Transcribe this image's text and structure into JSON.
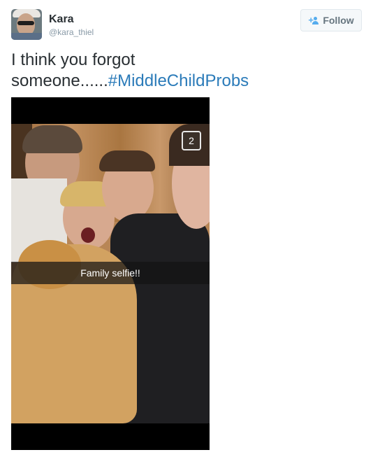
{
  "author": {
    "name": "Kara",
    "handle": "@kara_thiel",
    "avatar_icon": "profile-avatar"
  },
  "follow_button": {
    "label": "Follow",
    "icon": "add-user-icon"
  },
  "tweet": {
    "text_line1": "I think you forgot",
    "text_line2_prefix": "someone......",
    "hashtag": "#MiddleChildProbs"
  },
  "photo": {
    "caption": "Family selfie!!",
    "badge": "2"
  },
  "colors": {
    "hashtag": "#2b7bb9",
    "follow_icon": "#55acee",
    "text": "#292f33",
    "handle": "#8899a6"
  }
}
